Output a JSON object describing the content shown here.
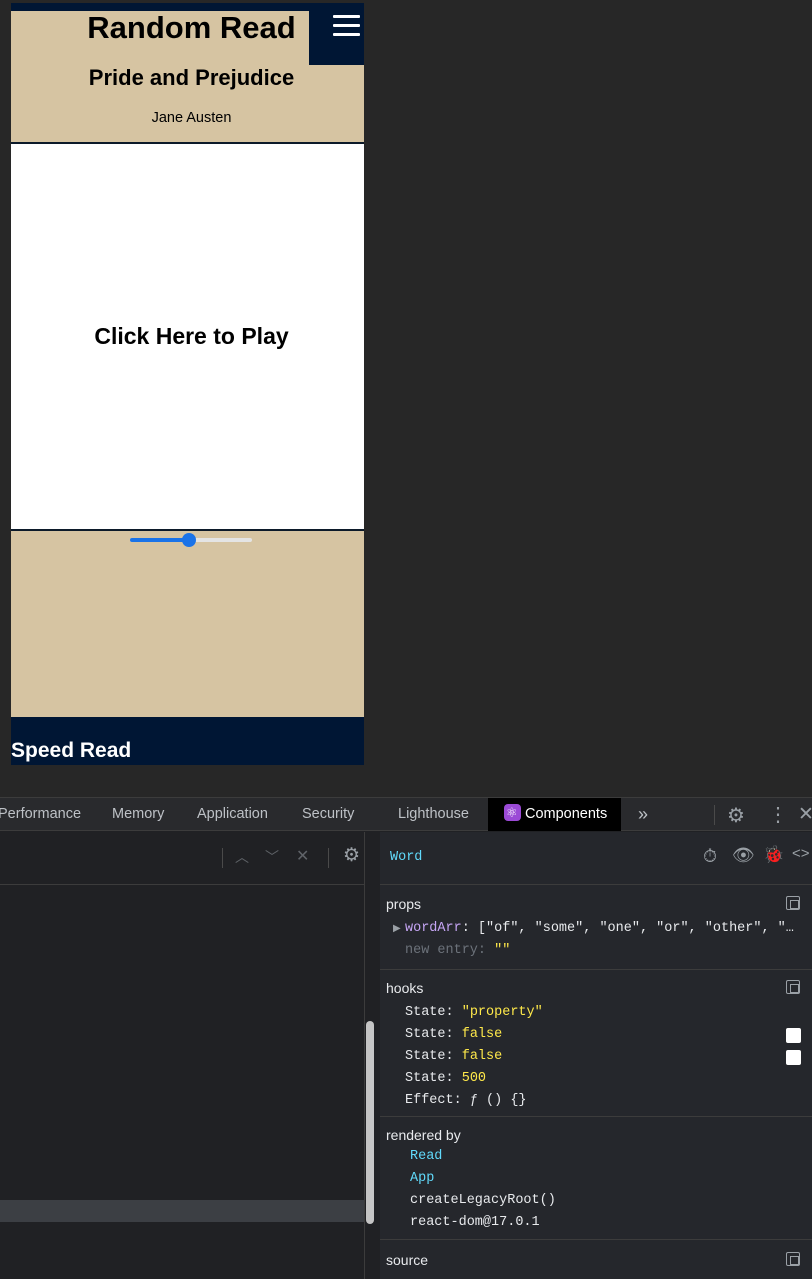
{
  "app": {
    "title": "Random Read",
    "book_title": "Pride and Prejudice",
    "book_author": "Jane Austen",
    "play_label": "Click Here to Play",
    "speed_slider_fraction": 0.48,
    "footer_label": "Speed Read",
    "colors": {
      "navy": "#001634",
      "tan": "#d6c4a2",
      "accent": "#1a73e8"
    }
  },
  "devtools": {
    "tabs": {
      "performance": "Performance",
      "memory": "Memory",
      "application": "Application",
      "security": "Security",
      "lighthouse": "Lighthouse",
      "components": "Components",
      "more": "»"
    },
    "component_name": "Word",
    "props": {
      "title": "props",
      "key1": "wordArr",
      "val1": "[\"of\", \"some\", \"one\", \"or\", \"other\", \"…",
      "key2": "new entry",
      "val2": "\"\""
    },
    "hooks": {
      "title": "hooks",
      "items": [
        {
          "key": "State",
          "value": "\"property\""
        },
        {
          "key": "State",
          "value": "false"
        },
        {
          "key": "State",
          "value": "false"
        },
        {
          "key": "State",
          "value": "500"
        },
        {
          "key": "Effect",
          "value": "ƒ () {}"
        }
      ]
    },
    "rendered_by": {
      "title": "rendered by",
      "items": [
        "Read",
        "App",
        "createLegacyRoot()",
        "react-dom@17.0.1"
      ]
    },
    "source": {
      "title": "source"
    }
  }
}
